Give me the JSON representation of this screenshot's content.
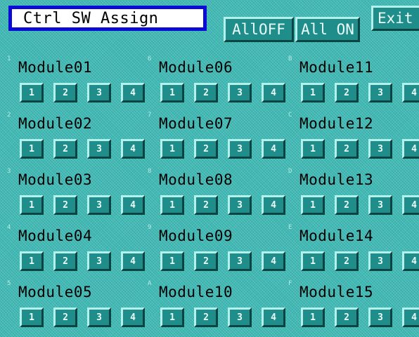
{
  "header": {
    "title": "Ctrl SW Assign",
    "all_off_label": "AllOFF",
    "all_on_label": "All ON",
    "exit_label": "Exit"
  },
  "switch_labels": [
    "1",
    "2",
    "3",
    "4"
  ],
  "modules": [
    {
      "index": "1",
      "label": "Module01"
    },
    {
      "index": "2",
      "label": "Module02"
    },
    {
      "index": "3",
      "label": "Module03"
    },
    {
      "index": "4",
      "label": "Module04"
    },
    {
      "index": "5",
      "label": "Module05"
    },
    {
      "index": "6",
      "label": "Module06"
    },
    {
      "index": "7",
      "label": "Module07"
    },
    {
      "index": "8",
      "label": "Module08"
    },
    {
      "index": "9",
      "label": "Module09"
    },
    {
      "index": "A",
      "label": "Module10"
    },
    {
      "index": "B",
      "label": "Module11"
    },
    {
      "index": "C",
      "label": "Module12"
    },
    {
      "index": "D",
      "label": "Module13"
    },
    {
      "index": "E",
      "label": "Module14"
    },
    {
      "index": "F",
      "label": "Module15"
    }
  ],
  "colors": {
    "background": "#3fb9b4",
    "button_face": "#1f8e8a",
    "title_border": "#0b0bd8"
  }
}
